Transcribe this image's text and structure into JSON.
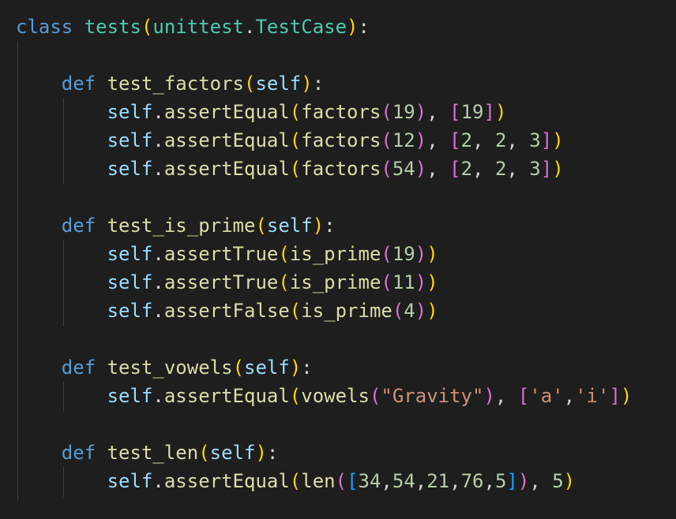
{
  "colors": {
    "background": "#1e1e1e",
    "keyword": "#569cd6",
    "function": "#dcdcaa",
    "class": "#4ec9b0",
    "self": "#9cdcfe",
    "number": "#b5cea8",
    "string": "#ce9178",
    "punctuation": "#d4d4d4",
    "bracket_level_1": "#ffd700",
    "bracket_level_2": "#da70d6",
    "bracket_level_3": "#179fff",
    "indent_guide": "#404040"
  },
  "code": {
    "lines": [
      [
        [
          "kw",
          "class"
        ],
        [
          "pun",
          " "
        ],
        [
          "cls",
          "tests"
        ],
        [
          "b1",
          "("
        ],
        [
          "cls",
          "unittest"
        ],
        [
          "pun",
          "."
        ],
        [
          "cls",
          "TestCase"
        ],
        [
          "b1",
          ")"
        ],
        [
          "pun",
          ":"
        ]
      ],
      [],
      [
        [
          "pun",
          "    "
        ],
        [
          "kw",
          "def"
        ],
        [
          "pun",
          " "
        ],
        [
          "fn",
          "test_factors"
        ],
        [
          "b1",
          "("
        ],
        [
          "self",
          "self"
        ],
        [
          "b1",
          ")"
        ],
        [
          "pun",
          ":"
        ]
      ],
      [
        [
          "pun",
          "        "
        ],
        [
          "self",
          "self"
        ],
        [
          "pun",
          "."
        ],
        [
          "fn",
          "assertEqual"
        ],
        [
          "b1",
          "("
        ],
        [
          "fn",
          "factors"
        ],
        [
          "b2",
          "("
        ],
        [
          "num",
          "19"
        ],
        [
          "b2",
          ")"
        ],
        [
          "pun",
          ", "
        ],
        [
          "b2",
          "["
        ],
        [
          "num",
          "19"
        ],
        [
          "b2",
          "]"
        ],
        [
          "b1",
          ")"
        ]
      ],
      [
        [
          "pun",
          "        "
        ],
        [
          "self",
          "self"
        ],
        [
          "pun",
          "."
        ],
        [
          "fn",
          "assertEqual"
        ],
        [
          "b1",
          "("
        ],
        [
          "fn",
          "factors"
        ],
        [
          "b2",
          "("
        ],
        [
          "num",
          "12"
        ],
        [
          "b2",
          ")"
        ],
        [
          "pun",
          ", "
        ],
        [
          "b2",
          "["
        ],
        [
          "num",
          "2"
        ],
        [
          "pun",
          ", "
        ],
        [
          "num",
          "2"
        ],
        [
          "pun",
          ", "
        ],
        [
          "num",
          "3"
        ],
        [
          "b2",
          "]"
        ],
        [
          "b1",
          ")"
        ]
      ],
      [
        [
          "pun",
          "        "
        ],
        [
          "self",
          "self"
        ],
        [
          "pun",
          "."
        ],
        [
          "fn",
          "assertEqual"
        ],
        [
          "b1",
          "("
        ],
        [
          "fn",
          "factors"
        ],
        [
          "b2",
          "("
        ],
        [
          "num",
          "54"
        ],
        [
          "b2",
          ")"
        ],
        [
          "pun",
          ", "
        ],
        [
          "b2",
          "["
        ],
        [
          "num",
          "2"
        ],
        [
          "pun",
          ", "
        ],
        [
          "num",
          "2"
        ],
        [
          "pun",
          ", "
        ],
        [
          "num",
          "3"
        ],
        [
          "b2",
          "]"
        ],
        [
          "b1",
          ")"
        ]
      ],
      [],
      [
        [
          "pun",
          "    "
        ],
        [
          "kw",
          "def"
        ],
        [
          "pun",
          " "
        ],
        [
          "fn",
          "test_is_prime"
        ],
        [
          "b1",
          "("
        ],
        [
          "self",
          "self"
        ],
        [
          "b1",
          ")"
        ],
        [
          "pun",
          ":"
        ]
      ],
      [
        [
          "pun",
          "        "
        ],
        [
          "self",
          "self"
        ],
        [
          "pun",
          "."
        ],
        [
          "fn",
          "assertTrue"
        ],
        [
          "b1",
          "("
        ],
        [
          "fn",
          "is_prime"
        ],
        [
          "b2",
          "("
        ],
        [
          "num",
          "19"
        ],
        [
          "b2",
          ")"
        ],
        [
          "b1",
          ")"
        ]
      ],
      [
        [
          "pun",
          "        "
        ],
        [
          "self",
          "self"
        ],
        [
          "pun",
          "."
        ],
        [
          "fn",
          "assertTrue"
        ],
        [
          "b1",
          "("
        ],
        [
          "fn",
          "is_prime"
        ],
        [
          "b2",
          "("
        ],
        [
          "num",
          "11"
        ],
        [
          "b2",
          ")"
        ],
        [
          "b1",
          ")"
        ]
      ],
      [
        [
          "pun",
          "        "
        ],
        [
          "self",
          "self"
        ],
        [
          "pun",
          "."
        ],
        [
          "fn",
          "assertFalse"
        ],
        [
          "b1",
          "("
        ],
        [
          "fn",
          "is_prime"
        ],
        [
          "b2",
          "("
        ],
        [
          "num",
          "4"
        ],
        [
          "b2",
          ")"
        ],
        [
          "b1",
          ")"
        ]
      ],
      [],
      [
        [
          "pun",
          "    "
        ],
        [
          "kw",
          "def"
        ],
        [
          "pun",
          " "
        ],
        [
          "fn",
          "test_vowels"
        ],
        [
          "b1",
          "("
        ],
        [
          "self",
          "self"
        ],
        [
          "b1",
          ")"
        ],
        [
          "pun",
          ":"
        ]
      ],
      [
        [
          "pun",
          "        "
        ],
        [
          "self",
          "self"
        ],
        [
          "pun",
          "."
        ],
        [
          "fn",
          "assertEqual"
        ],
        [
          "b1",
          "("
        ],
        [
          "fn",
          "vowels"
        ],
        [
          "b2",
          "("
        ],
        [
          "str",
          "\"Gravity\""
        ],
        [
          "b2",
          ")"
        ],
        [
          "pun",
          ", "
        ],
        [
          "b2",
          "["
        ],
        [
          "str",
          "'a'"
        ],
        [
          "pun",
          ","
        ],
        [
          "str",
          "'i'"
        ],
        [
          "b2",
          "]"
        ],
        [
          "b1",
          ")"
        ]
      ],
      [],
      [
        [
          "pun",
          "    "
        ],
        [
          "kw",
          "def"
        ],
        [
          "pun",
          " "
        ],
        [
          "fn",
          "test_len"
        ],
        [
          "b1",
          "("
        ],
        [
          "self",
          "self"
        ],
        [
          "b1",
          ")"
        ],
        [
          "pun",
          ":"
        ]
      ],
      [
        [
          "pun",
          "        "
        ],
        [
          "self",
          "self"
        ],
        [
          "pun",
          "."
        ],
        [
          "fn",
          "assertEqual"
        ],
        [
          "b1",
          "("
        ],
        [
          "fn",
          "len"
        ],
        [
          "b2",
          "("
        ],
        [
          "b3",
          "["
        ],
        [
          "num",
          "34"
        ],
        [
          "pun",
          ","
        ],
        [
          "num",
          "54"
        ],
        [
          "pun",
          ","
        ],
        [
          "num",
          "21"
        ],
        [
          "pun",
          ","
        ],
        [
          "num",
          "76"
        ],
        [
          "pun",
          ","
        ],
        [
          "num",
          "5"
        ],
        [
          "b3",
          "]"
        ],
        [
          "b2",
          ")"
        ],
        [
          "pun",
          ", "
        ],
        [
          "num",
          "5"
        ],
        [
          "b1",
          ")"
        ]
      ]
    ]
  }
}
